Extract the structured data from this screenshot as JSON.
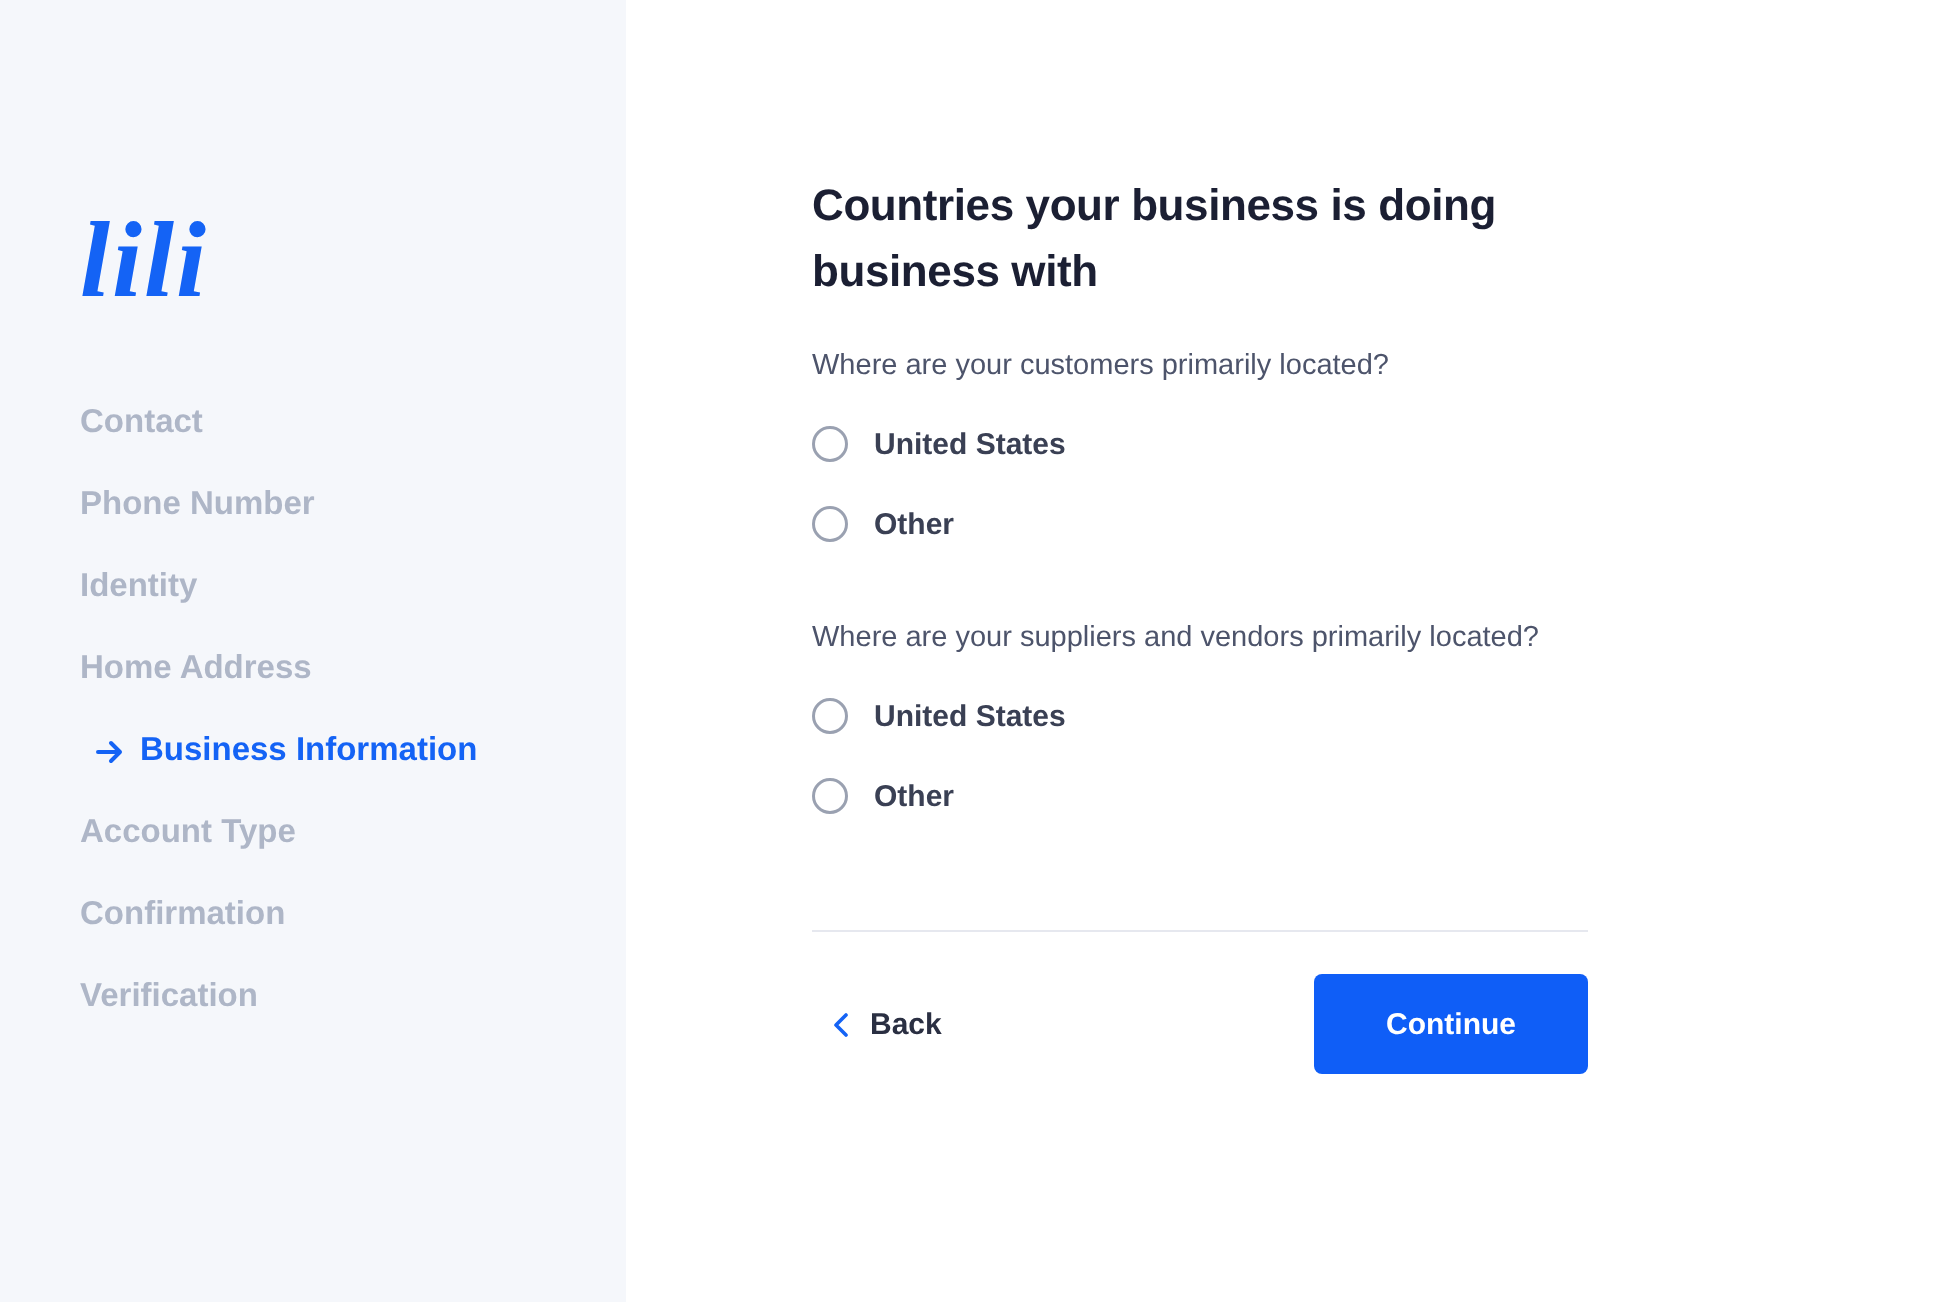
{
  "logo": {
    "text": "lili"
  },
  "steps": [
    {
      "label": "Contact",
      "selected": false
    },
    {
      "label": "Phone Number",
      "selected": false
    },
    {
      "label": "Identity",
      "selected": false
    },
    {
      "label": "Home Address",
      "selected": false
    },
    {
      "label": "Business Information",
      "selected": true
    },
    {
      "label": "Account Type",
      "selected": false
    },
    {
      "label": "Confirmation",
      "selected": false
    },
    {
      "label": "Verification",
      "selected": false
    }
  ],
  "form": {
    "title": "Countries your business is doing business with",
    "questions": [
      {
        "prompt": "Where are your customers primarily located?",
        "options": [
          {
            "label": "United States",
            "selected": false
          },
          {
            "label": "Other",
            "selected": false
          }
        ]
      },
      {
        "prompt": "Where are your suppliers and vendors primarily located?",
        "options": [
          {
            "label": "United States",
            "selected": false
          },
          {
            "label": "Other",
            "selected": false
          }
        ]
      }
    ]
  },
  "actions": {
    "back": "Back",
    "continue": "Continue"
  }
}
